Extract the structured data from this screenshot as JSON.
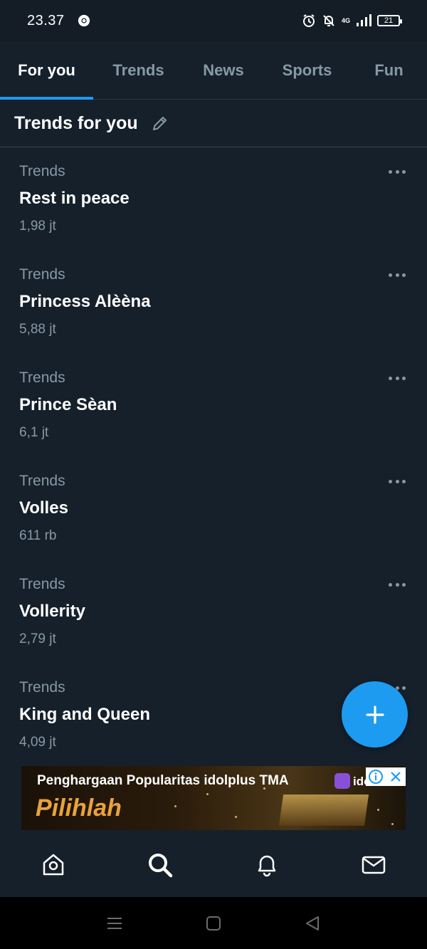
{
  "status_bar": {
    "time": "23.37",
    "network": "4G",
    "battery": "21"
  },
  "tabs": [
    {
      "label": "For you",
      "active": true
    },
    {
      "label": "Trends",
      "active": false
    },
    {
      "label": "News",
      "active": false
    },
    {
      "label": "Sports",
      "active": false
    },
    {
      "label": "Fun",
      "active": false
    }
  ],
  "section": {
    "title": "Trends for you"
  },
  "trends": [
    {
      "category": "Trends",
      "name": "Rest in peace",
      "count": "1,98 jt"
    },
    {
      "category": "Trends",
      "name": "Princess Alèèna",
      "count": "5,88 jt"
    },
    {
      "category": "Trends",
      "name": "Prince Sèan",
      "count": "6,1 jt"
    },
    {
      "category": "Trends",
      "name": "Volles",
      "count": "611 rb"
    },
    {
      "category": "Trends",
      "name": "Vollerity",
      "count": "2,79 jt"
    },
    {
      "category": "Trends",
      "name": "King and Queen",
      "count": "4,09 jt"
    }
  ],
  "ad": {
    "headline": "Penghargaan Popularitas idolplus TMA",
    "cta": "Pilihlah",
    "logo_text": "ido"
  },
  "bottom_nav": [
    {
      "icon": "home-icon"
    },
    {
      "icon": "search-icon",
      "active": true
    },
    {
      "icon": "notifications-icon"
    },
    {
      "icon": "messages-icon"
    }
  ],
  "colors": {
    "background": "#15202b",
    "accent": "#1d9bf0",
    "secondary_text": "#8899a6"
  }
}
